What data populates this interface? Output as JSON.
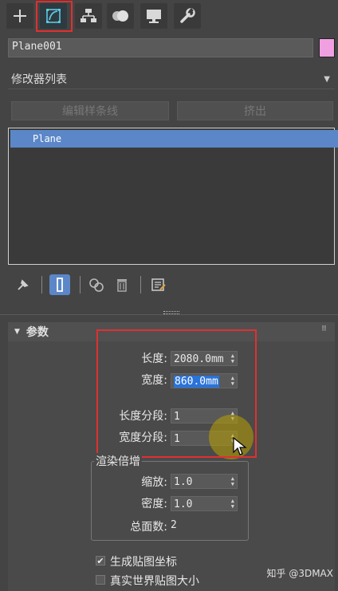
{
  "object_name": "Plane001",
  "object_color": "#f0a0e0",
  "modifier_list_label": "修改器列表",
  "buttons": {
    "edit_spline": "编辑样条线",
    "extrude": "挤出"
  },
  "stack_items": [
    "Plane"
  ],
  "rollout_title": "参数",
  "params": {
    "length_label": "长度:",
    "length_value": "2080.0mm",
    "width_label": "宽度:",
    "width_value": "860.0mm",
    "length_segs_label": "长度分段:",
    "length_segs_value": "1",
    "width_segs_label": "宽度分段:",
    "width_segs_value": "1"
  },
  "render_multipliers": {
    "title": "渲染倍增",
    "scale_label": "缩放:",
    "scale_value": "1.0",
    "density_label": "密度:",
    "density_value": "1.0",
    "total_faces_label": "总面数:",
    "total_faces_value": "2"
  },
  "checkboxes": {
    "gen_mapping_label": "生成贴图坐标",
    "gen_mapping_checked": "✔",
    "real_world_label": "真实世界贴图大小"
  },
  "watermark": "知乎 @3DMAX",
  "colors": {
    "accent_red": "#e03030",
    "selection_blue": "#5b87c8",
    "highlight_blue": "#2a73d9",
    "cursor_highlight": "#b8a000"
  },
  "icons": [
    "plus-icon",
    "modify-icon",
    "hierarchy-icon",
    "motion-icon",
    "display-icon",
    "utilities-icon",
    "pin-stack-icon",
    "show-end-result-icon",
    "make-unique-icon",
    "remove-modifier-icon",
    "configure-sets-icon",
    "cursor-icon"
  ]
}
